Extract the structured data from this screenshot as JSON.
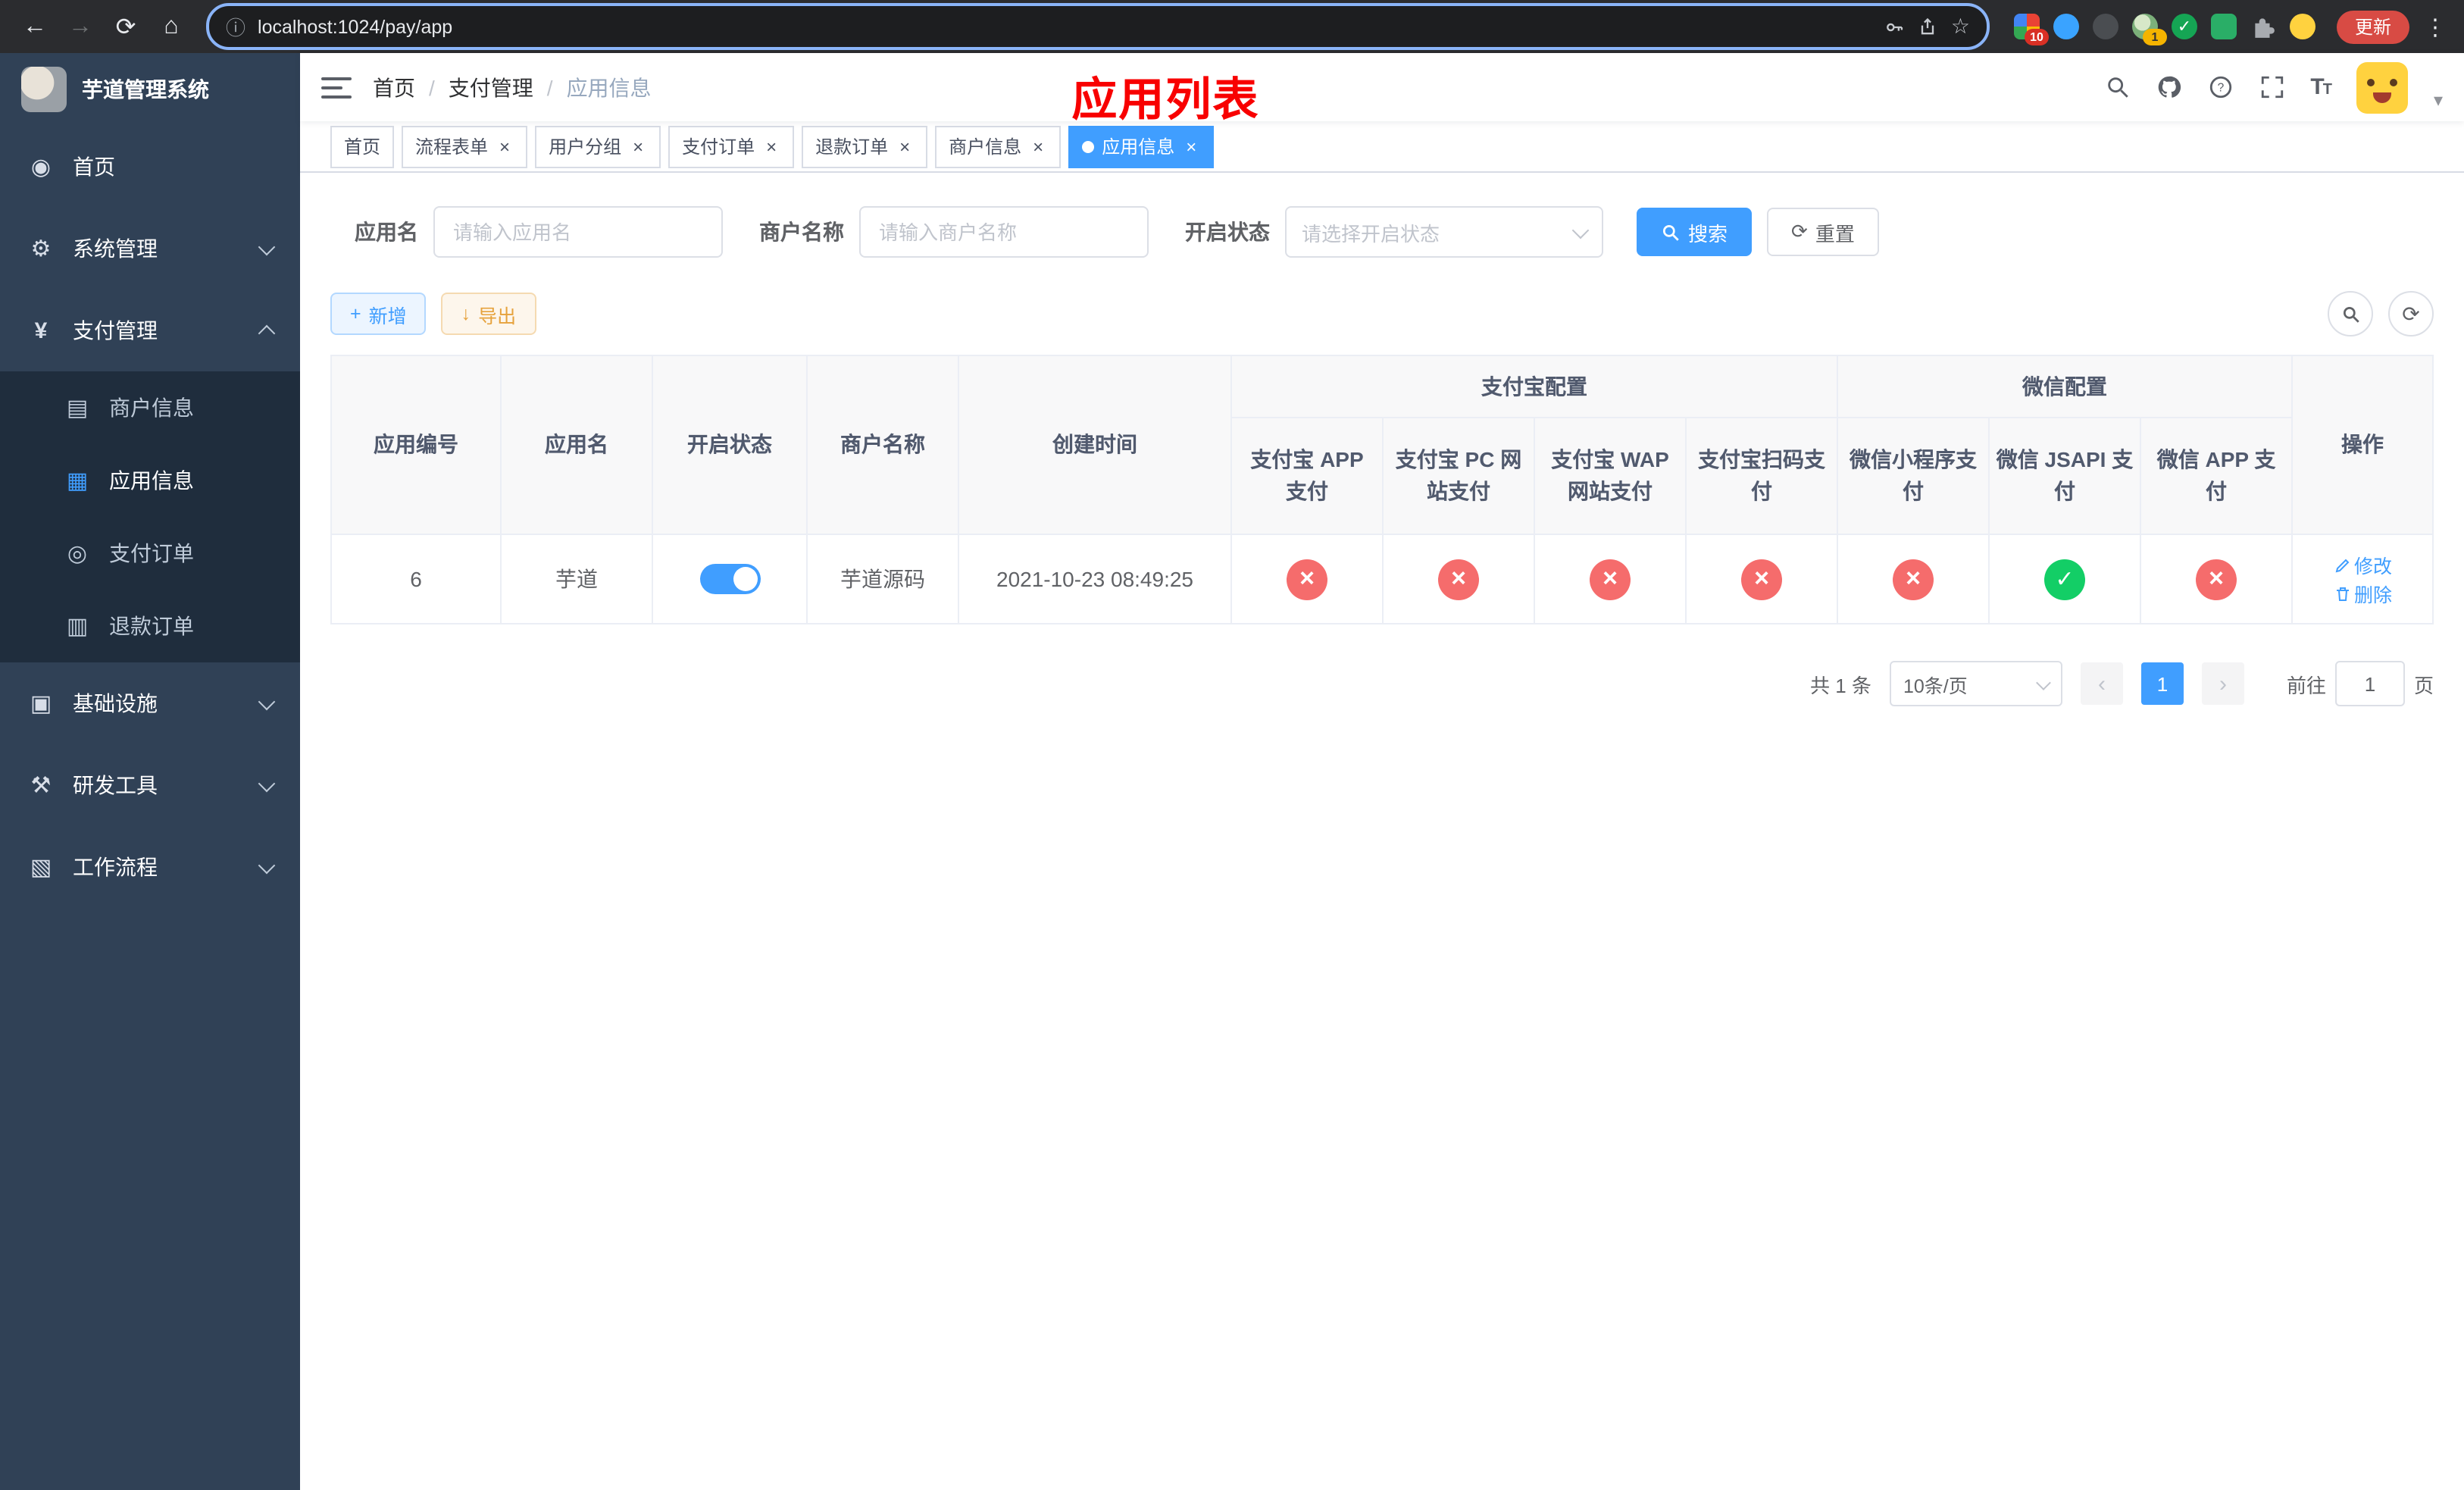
{
  "colors": {
    "accent": "#409eff",
    "success": "#13ce66",
    "danger": "#f56c6c",
    "warning": "#e6a23c",
    "title_red": "#f80000",
    "sidebar_bg": "#304156",
    "submenu_bg": "#1f2d3d"
  },
  "icons": {
    "back": "←",
    "forward": "→",
    "reload": "⟳",
    "home": "⌂",
    "info": "ⓘ",
    "star": "☆",
    "menu_dots": "⋮",
    "dashboard": "◉",
    "system": "⚙",
    "payment": "¥",
    "merchant": "▤",
    "app_info": "▦",
    "pay_order": "◎",
    "refund_order": "▥",
    "infra": "▣",
    "devtools": "⚒",
    "workflow": "▧",
    "plus": "+",
    "download": "↓",
    "refresh": "⟳",
    "check": "✓",
    "cross": "×",
    "prev": "‹",
    "next": "›",
    "caret_down": "▾",
    "font_size_big": "T",
    "font_size_small": "T"
  },
  "browser": {
    "url": "localhost:1024/pay/app",
    "update_button": "更新",
    "extension_badge_count": "10",
    "avatar_badge_count": "1"
  },
  "sidebar": {
    "logo_title": "芋道管理系统",
    "items": [
      {
        "label": "首页"
      },
      {
        "label": "系统管理"
      },
      {
        "label": "支付管理",
        "children": [
          {
            "label": "商户信息"
          },
          {
            "label": "应用信息"
          },
          {
            "label": "支付订单"
          },
          {
            "label": "退款订单"
          }
        ]
      },
      {
        "label": "基础设施"
      },
      {
        "label": "研发工具"
      },
      {
        "label": "工作流程"
      }
    ]
  },
  "header": {
    "breadcrumb": [
      {
        "label": "首页"
      },
      {
        "label": "支付管理"
      },
      {
        "label": "应用信息"
      }
    ],
    "overlay_title": "应用列表"
  },
  "tabs": [
    {
      "label": "首页",
      "closable": false,
      "active": false
    },
    {
      "label": "流程表单",
      "closable": true,
      "active": false
    },
    {
      "label": "用户分组",
      "closable": true,
      "active": false
    },
    {
      "label": "支付订单",
      "closable": true,
      "active": false
    },
    {
      "label": "退款订单",
      "closable": true,
      "active": false
    },
    {
      "label": "商户信息",
      "closable": true,
      "active": false
    },
    {
      "label": "应用信息",
      "closable": true,
      "active": true
    }
  ],
  "filters": {
    "app_name_label": "应用名",
    "app_name_placeholder": "请输入应用名",
    "merchant_label": "商户名称",
    "merchant_placeholder": "请输入商户名称",
    "status_label": "开启状态",
    "status_placeholder": "请选择开启状态",
    "search_button": "搜索",
    "reset_button": "重置"
  },
  "toolbar": {
    "add_button": "新增",
    "export_button": "导出"
  },
  "table": {
    "group_headers": {
      "alipay": "支付宝配置",
      "wechat": "微信配置"
    },
    "columns": [
      "应用编号",
      "应用名",
      "开启状态",
      "商户名称",
      "创建时间",
      "支付宝 APP 支付",
      "支付宝 PC 网站支付",
      "支付宝 WAP 网站支付",
      "支付宝扫码支付",
      "微信小程序支付",
      "微信 JSAPI 支付",
      "微信 APP 支付",
      "操作"
    ],
    "rows": [
      {
        "id": "6",
        "name": "芋道",
        "status_on": true,
        "merchant": "芋道源码",
        "created": "2021-10-23 08:49:25",
        "channels": {
          "alipay_app": false,
          "alipay_pc": false,
          "alipay_wap": false,
          "alipay_qr": false,
          "wx_lite": false,
          "wx_jsapi": true,
          "wx_app": false
        },
        "edit_label": "修改",
        "delete_label": "删除"
      }
    ]
  },
  "pagination": {
    "total_text": "共 1 条",
    "page_size_text": "10条/页",
    "current_page": "1",
    "goto_label": "前往",
    "goto_value": "1",
    "goto_unit": "页"
  }
}
